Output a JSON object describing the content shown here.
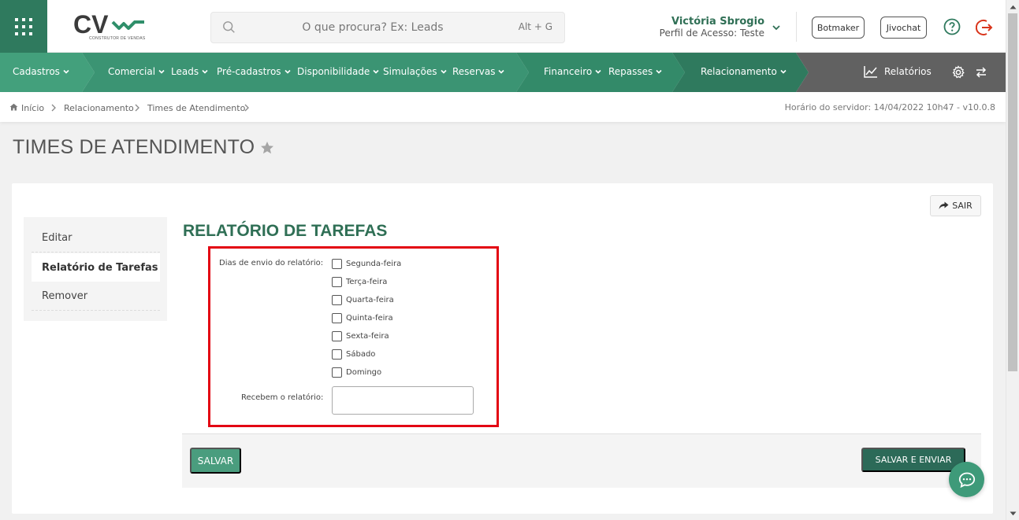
{
  "header": {
    "logo_text": "CV",
    "logo_subtext": "CONSTRUTOR DE VENDAS",
    "search": {
      "placeholder": "O que procura? Ex: Leads",
      "shortcut": "Alt + G"
    },
    "user": {
      "name": "Victória Sbrogio",
      "profile": "Perfil de Acesso: Teste"
    },
    "buttons": {
      "botmaker": "Botmaker",
      "jivochat": "Jivochat"
    }
  },
  "nav": {
    "items": [
      {
        "label": "Cadastros"
      },
      {
        "label": "Comercial"
      },
      {
        "label": "Leads"
      },
      {
        "label": "Pré-cadastros"
      },
      {
        "label": "Disponibilidade"
      },
      {
        "label": "Simulações"
      },
      {
        "label": "Reservas"
      },
      {
        "label": "Financeiro"
      },
      {
        "label": "Repasses"
      },
      {
        "label": "Relacionamento"
      }
    ],
    "reports_label": "Relatórios"
  },
  "breadcrumb": {
    "items": [
      "Início",
      "Relacionamento",
      "Times de Atendimento"
    ],
    "server_time": "Horário do servidor: 14/04/2022 10h47 - v10.0.8"
  },
  "page": {
    "title": "TIMES DE ATENDIMENTO"
  },
  "sidemenu": {
    "items": [
      {
        "label": "Editar"
      },
      {
        "label": "Relatório de Tarefas"
      },
      {
        "label": "Remover"
      }
    ]
  },
  "form": {
    "title": "RELATÓRIO DE TAREFAS",
    "exit_label": "SAIR",
    "days_label": "Dias de envio do relatório:",
    "days": [
      "Segunda-feira",
      "Terça-feira",
      "Quarta-feira",
      "Quinta-feira",
      "Sexta-feira",
      "Sábado",
      "Domingo"
    ],
    "recipients_label": "Recebem o relatório:",
    "recipients_value": ""
  },
  "actions": {
    "save": "SALVAR",
    "save_send": "SALVAR E ENVIAR"
  },
  "colors": {
    "brand_green": "#2f7a5e",
    "nav_light": "#43a07c",
    "nav_dark": "#2f7a5e",
    "nav_gray": "#616161",
    "highlight_red": "#e30613"
  }
}
